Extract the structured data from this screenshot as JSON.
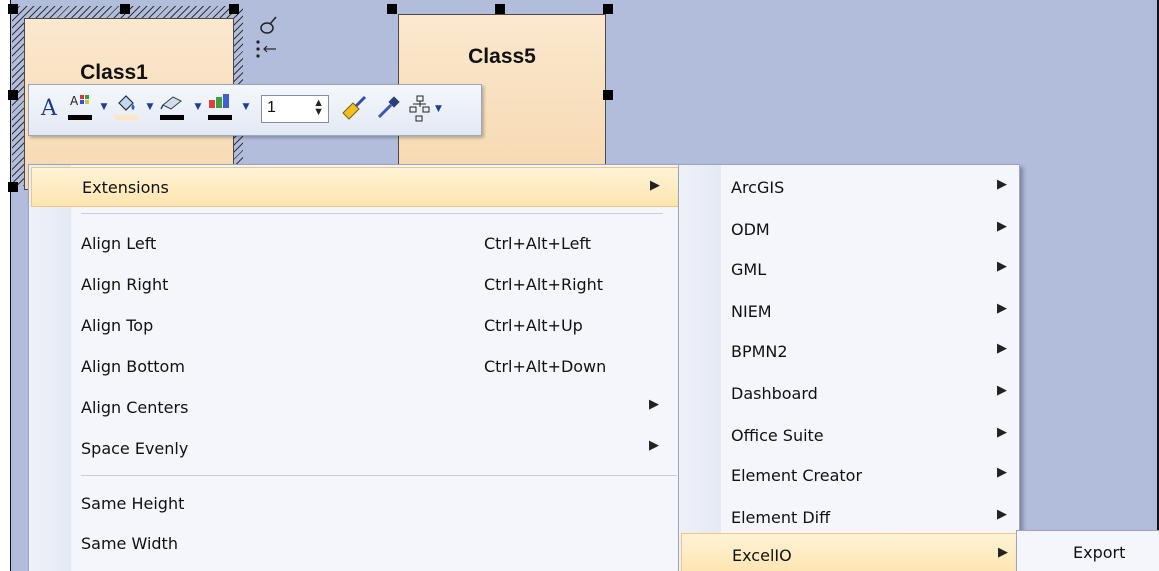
{
  "diagram": {
    "class1": {
      "title": "Class1"
    },
    "class5": {
      "title": "Class5"
    }
  },
  "toolbar": {
    "line_width": "1",
    "icons": [
      "font-icon",
      "font-color-icon",
      "fill-color-icon",
      "line-color-icon",
      "line-width-stepper",
      "format-painter-icon",
      "eyedropper-icon",
      "layout-icon"
    ]
  },
  "context_menu": {
    "extensions": {
      "label": "Extensions"
    },
    "align_left": {
      "label": "Align Left",
      "shortcut": "Ctrl+Alt+Left"
    },
    "align_right": {
      "label": "Align Right",
      "shortcut": "Ctrl+Alt+Right"
    },
    "align_top": {
      "label": "Align Top",
      "shortcut": "Ctrl+Alt+Up"
    },
    "align_bottom": {
      "label": "Align Bottom",
      "shortcut": "Ctrl+Alt+Down"
    },
    "align_centers": {
      "label": "Align Centers"
    },
    "space_evenly": {
      "label": "Space Evenly"
    },
    "same_height": {
      "label": "Same Height"
    },
    "same_width": {
      "label": "Same Width"
    }
  },
  "extensions_menu": {
    "arcgis": "ArcGIS",
    "odm": "ODM",
    "gml": "GML",
    "niem": "NIEM",
    "bpmn2": "BPMN2",
    "dashboard": "Dashboard",
    "office_suite": "Office Suite",
    "element_creator": "Element Creator",
    "element_diff": "Element Diff",
    "excelio": "ExcelIO"
  },
  "excelio_menu": {
    "export": "Export"
  },
  "colors": {
    "diagram_bg": "#b2bddb",
    "class_fill": "#f6d9b1",
    "menu_bg": "#f4f6fb",
    "highlight": "#fde5b0"
  }
}
